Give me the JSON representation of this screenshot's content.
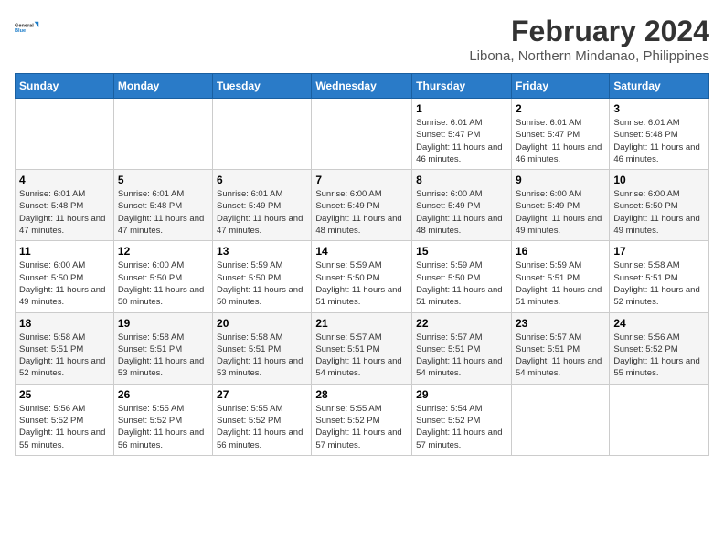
{
  "logo": {
    "line1": "General",
    "line2": "Blue"
  },
  "title": "February 2024",
  "subtitle": "Libona, Northern Mindanao, Philippines",
  "days_header": [
    "Sunday",
    "Monday",
    "Tuesday",
    "Wednesday",
    "Thursday",
    "Friday",
    "Saturday"
  ],
  "weeks": [
    [
      {
        "num": "",
        "info": ""
      },
      {
        "num": "",
        "info": ""
      },
      {
        "num": "",
        "info": ""
      },
      {
        "num": "",
        "info": ""
      },
      {
        "num": "1",
        "info": "Sunrise: 6:01 AM\nSunset: 5:47 PM\nDaylight: 11 hours and 46 minutes."
      },
      {
        "num": "2",
        "info": "Sunrise: 6:01 AM\nSunset: 5:47 PM\nDaylight: 11 hours and 46 minutes."
      },
      {
        "num": "3",
        "info": "Sunrise: 6:01 AM\nSunset: 5:48 PM\nDaylight: 11 hours and 46 minutes."
      }
    ],
    [
      {
        "num": "4",
        "info": "Sunrise: 6:01 AM\nSunset: 5:48 PM\nDaylight: 11 hours and 47 minutes."
      },
      {
        "num": "5",
        "info": "Sunrise: 6:01 AM\nSunset: 5:48 PM\nDaylight: 11 hours and 47 minutes."
      },
      {
        "num": "6",
        "info": "Sunrise: 6:01 AM\nSunset: 5:49 PM\nDaylight: 11 hours and 47 minutes."
      },
      {
        "num": "7",
        "info": "Sunrise: 6:00 AM\nSunset: 5:49 PM\nDaylight: 11 hours and 48 minutes."
      },
      {
        "num": "8",
        "info": "Sunrise: 6:00 AM\nSunset: 5:49 PM\nDaylight: 11 hours and 48 minutes."
      },
      {
        "num": "9",
        "info": "Sunrise: 6:00 AM\nSunset: 5:49 PM\nDaylight: 11 hours and 49 minutes."
      },
      {
        "num": "10",
        "info": "Sunrise: 6:00 AM\nSunset: 5:50 PM\nDaylight: 11 hours and 49 minutes."
      }
    ],
    [
      {
        "num": "11",
        "info": "Sunrise: 6:00 AM\nSunset: 5:50 PM\nDaylight: 11 hours and 49 minutes."
      },
      {
        "num": "12",
        "info": "Sunrise: 6:00 AM\nSunset: 5:50 PM\nDaylight: 11 hours and 50 minutes."
      },
      {
        "num": "13",
        "info": "Sunrise: 5:59 AM\nSunset: 5:50 PM\nDaylight: 11 hours and 50 minutes."
      },
      {
        "num": "14",
        "info": "Sunrise: 5:59 AM\nSunset: 5:50 PM\nDaylight: 11 hours and 51 minutes."
      },
      {
        "num": "15",
        "info": "Sunrise: 5:59 AM\nSunset: 5:50 PM\nDaylight: 11 hours and 51 minutes."
      },
      {
        "num": "16",
        "info": "Sunrise: 5:59 AM\nSunset: 5:51 PM\nDaylight: 11 hours and 51 minutes."
      },
      {
        "num": "17",
        "info": "Sunrise: 5:58 AM\nSunset: 5:51 PM\nDaylight: 11 hours and 52 minutes."
      }
    ],
    [
      {
        "num": "18",
        "info": "Sunrise: 5:58 AM\nSunset: 5:51 PM\nDaylight: 11 hours and 52 minutes."
      },
      {
        "num": "19",
        "info": "Sunrise: 5:58 AM\nSunset: 5:51 PM\nDaylight: 11 hours and 53 minutes."
      },
      {
        "num": "20",
        "info": "Sunrise: 5:58 AM\nSunset: 5:51 PM\nDaylight: 11 hours and 53 minutes."
      },
      {
        "num": "21",
        "info": "Sunrise: 5:57 AM\nSunset: 5:51 PM\nDaylight: 11 hours and 54 minutes."
      },
      {
        "num": "22",
        "info": "Sunrise: 5:57 AM\nSunset: 5:51 PM\nDaylight: 11 hours and 54 minutes."
      },
      {
        "num": "23",
        "info": "Sunrise: 5:57 AM\nSunset: 5:51 PM\nDaylight: 11 hours and 54 minutes."
      },
      {
        "num": "24",
        "info": "Sunrise: 5:56 AM\nSunset: 5:52 PM\nDaylight: 11 hours and 55 minutes."
      }
    ],
    [
      {
        "num": "25",
        "info": "Sunrise: 5:56 AM\nSunset: 5:52 PM\nDaylight: 11 hours and 55 minutes."
      },
      {
        "num": "26",
        "info": "Sunrise: 5:55 AM\nSunset: 5:52 PM\nDaylight: 11 hours and 56 minutes."
      },
      {
        "num": "27",
        "info": "Sunrise: 5:55 AM\nSunset: 5:52 PM\nDaylight: 11 hours and 56 minutes."
      },
      {
        "num": "28",
        "info": "Sunrise: 5:55 AM\nSunset: 5:52 PM\nDaylight: 11 hours and 57 minutes."
      },
      {
        "num": "29",
        "info": "Sunrise: 5:54 AM\nSunset: 5:52 PM\nDaylight: 11 hours and 57 minutes."
      },
      {
        "num": "",
        "info": ""
      },
      {
        "num": "",
        "info": ""
      }
    ]
  ]
}
